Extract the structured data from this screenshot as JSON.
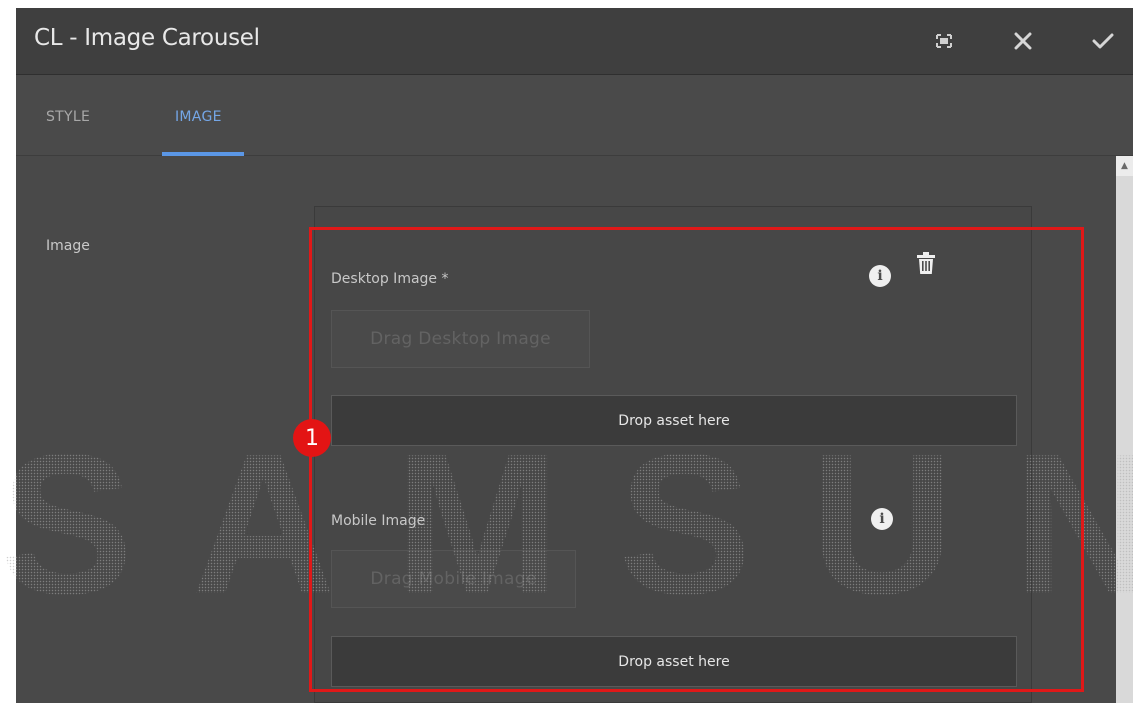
{
  "dialog": {
    "title": "CL - Image Carousel",
    "actions": [
      {
        "name": "fullscreen-icon"
      },
      {
        "name": "close-icon"
      },
      {
        "name": "check-icon"
      }
    ]
  },
  "tabs": [
    {
      "label": "STYLE",
      "active": false
    },
    {
      "label": "IMAGE",
      "active": true
    }
  ],
  "form": {
    "image_label": "Image",
    "desktop": {
      "label": "Desktop Image *",
      "drag_label": "Drag Desktop Image",
      "drop_label": "Drop asset here"
    },
    "mobile": {
      "label": "Mobile Image",
      "drag_label": "Drag Mobile Image",
      "drop_label": "Drop asset here"
    }
  },
  "overlay": {
    "watermark": "SAMSUNG",
    "callout_number": "1",
    "callout_color": "#e01818"
  },
  "colors": {
    "accent": "#5b97e6",
    "titlebar": "#3f3f3f",
    "body": "#4b4b4b"
  }
}
